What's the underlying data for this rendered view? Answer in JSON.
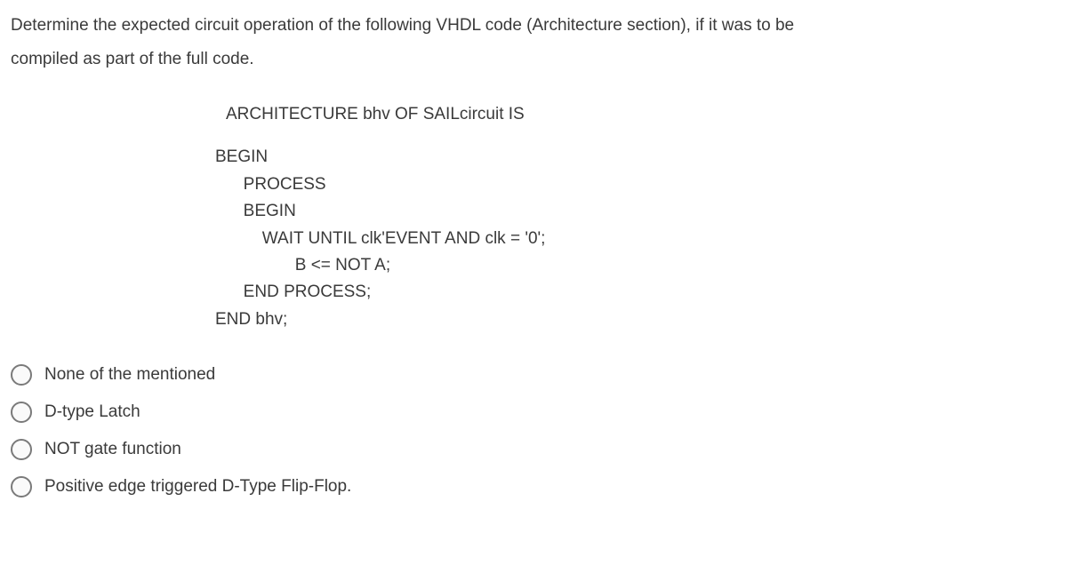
{
  "question": {
    "line1": "Determine the expected circuit operation of the following VHDL code (Architecture section), if it was to be",
    "line2": "compiled as part of the full code."
  },
  "code": {
    "l1": "ARCHITECTURE bhv OF SAILcircuit IS",
    "l2": "BEGIN",
    "l3": "      PROCESS",
    "l4": "      BEGIN",
    "l5": "          WAIT UNTIL clk'EVENT AND clk = '0';",
    "l6": "                 B <= NOT A;",
    "l7": "      END PROCESS;",
    "l8": "END bhv;"
  },
  "options": {
    "a": "None of the mentioned",
    "b": "D-type Latch",
    "c": "NOT gate function",
    "d": "Positive edge triggered D-Type Flip-Flop."
  }
}
